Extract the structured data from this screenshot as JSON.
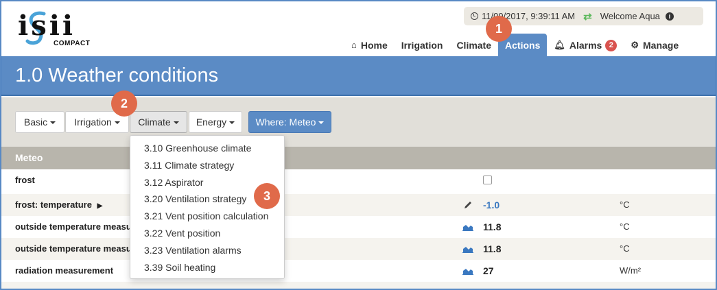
{
  "header": {
    "logo_text": "isii",
    "logo_subtitle": "COMPACT",
    "datetime": "11/09/2017, 9:39:11 AM",
    "welcome": "Welcome Aqua"
  },
  "nav": {
    "items": [
      {
        "label": "Home",
        "icon": "home-icon"
      },
      {
        "label": "Irrigation"
      },
      {
        "label": "Climate"
      },
      {
        "label": "Actions",
        "active": true
      },
      {
        "label": "Alarms",
        "icon": "bell-icon",
        "badge": "2"
      },
      {
        "label": "Manage",
        "icon": "gear-icon"
      }
    ]
  },
  "callouts": [
    "1",
    "2",
    "3"
  ],
  "page_title": "1.0 Weather conditions",
  "toolbar": {
    "basic": "Basic",
    "irrigation": "Irrigation",
    "climate": "Climate",
    "energy": "Energy",
    "where": "Where: Meteo"
  },
  "climate_menu": [
    "3.10 Greenhouse climate",
    "3.11 Climate strategy",
    "3.12 Aspirator",
    "3.20 Ventilation strategy",
    "3.21 Vent position calculation",
    "3.22 Vent position",
    "3.23 Ventilation alarms",
    "3.39 Soil heating"
  ],
  "section": "Meteo",
  "rows": [
    {
      "name": "frost",
      "value": "",
      "unit": "",
      "type": "checkbox"
    },
    {
      "name": "frost: temperature",
      "value": "-1.0",
      "unit": "°C",
      "type": "edit"
    },
    {
      "name": "outside temperature measurement",
      "value": "11.8",
      "unit": "°C",
      "type": "chart"
    },
    {
      "name": "outside temperature measurement",
      "value": "11.8",
      "unit": "°C",
      "type": "chart"
    },
    {
      "name": "radiation measurement",
      "value": "27",
      "unit": "W/m²",
      "type": "chart"
    }
  ],
  "colors": {
    "accent": "#5b8bc5",
    "callout": "#e06a4a",
    "badge": "#d9534f",
    "link_value": "#3a78c0"
  }
}
